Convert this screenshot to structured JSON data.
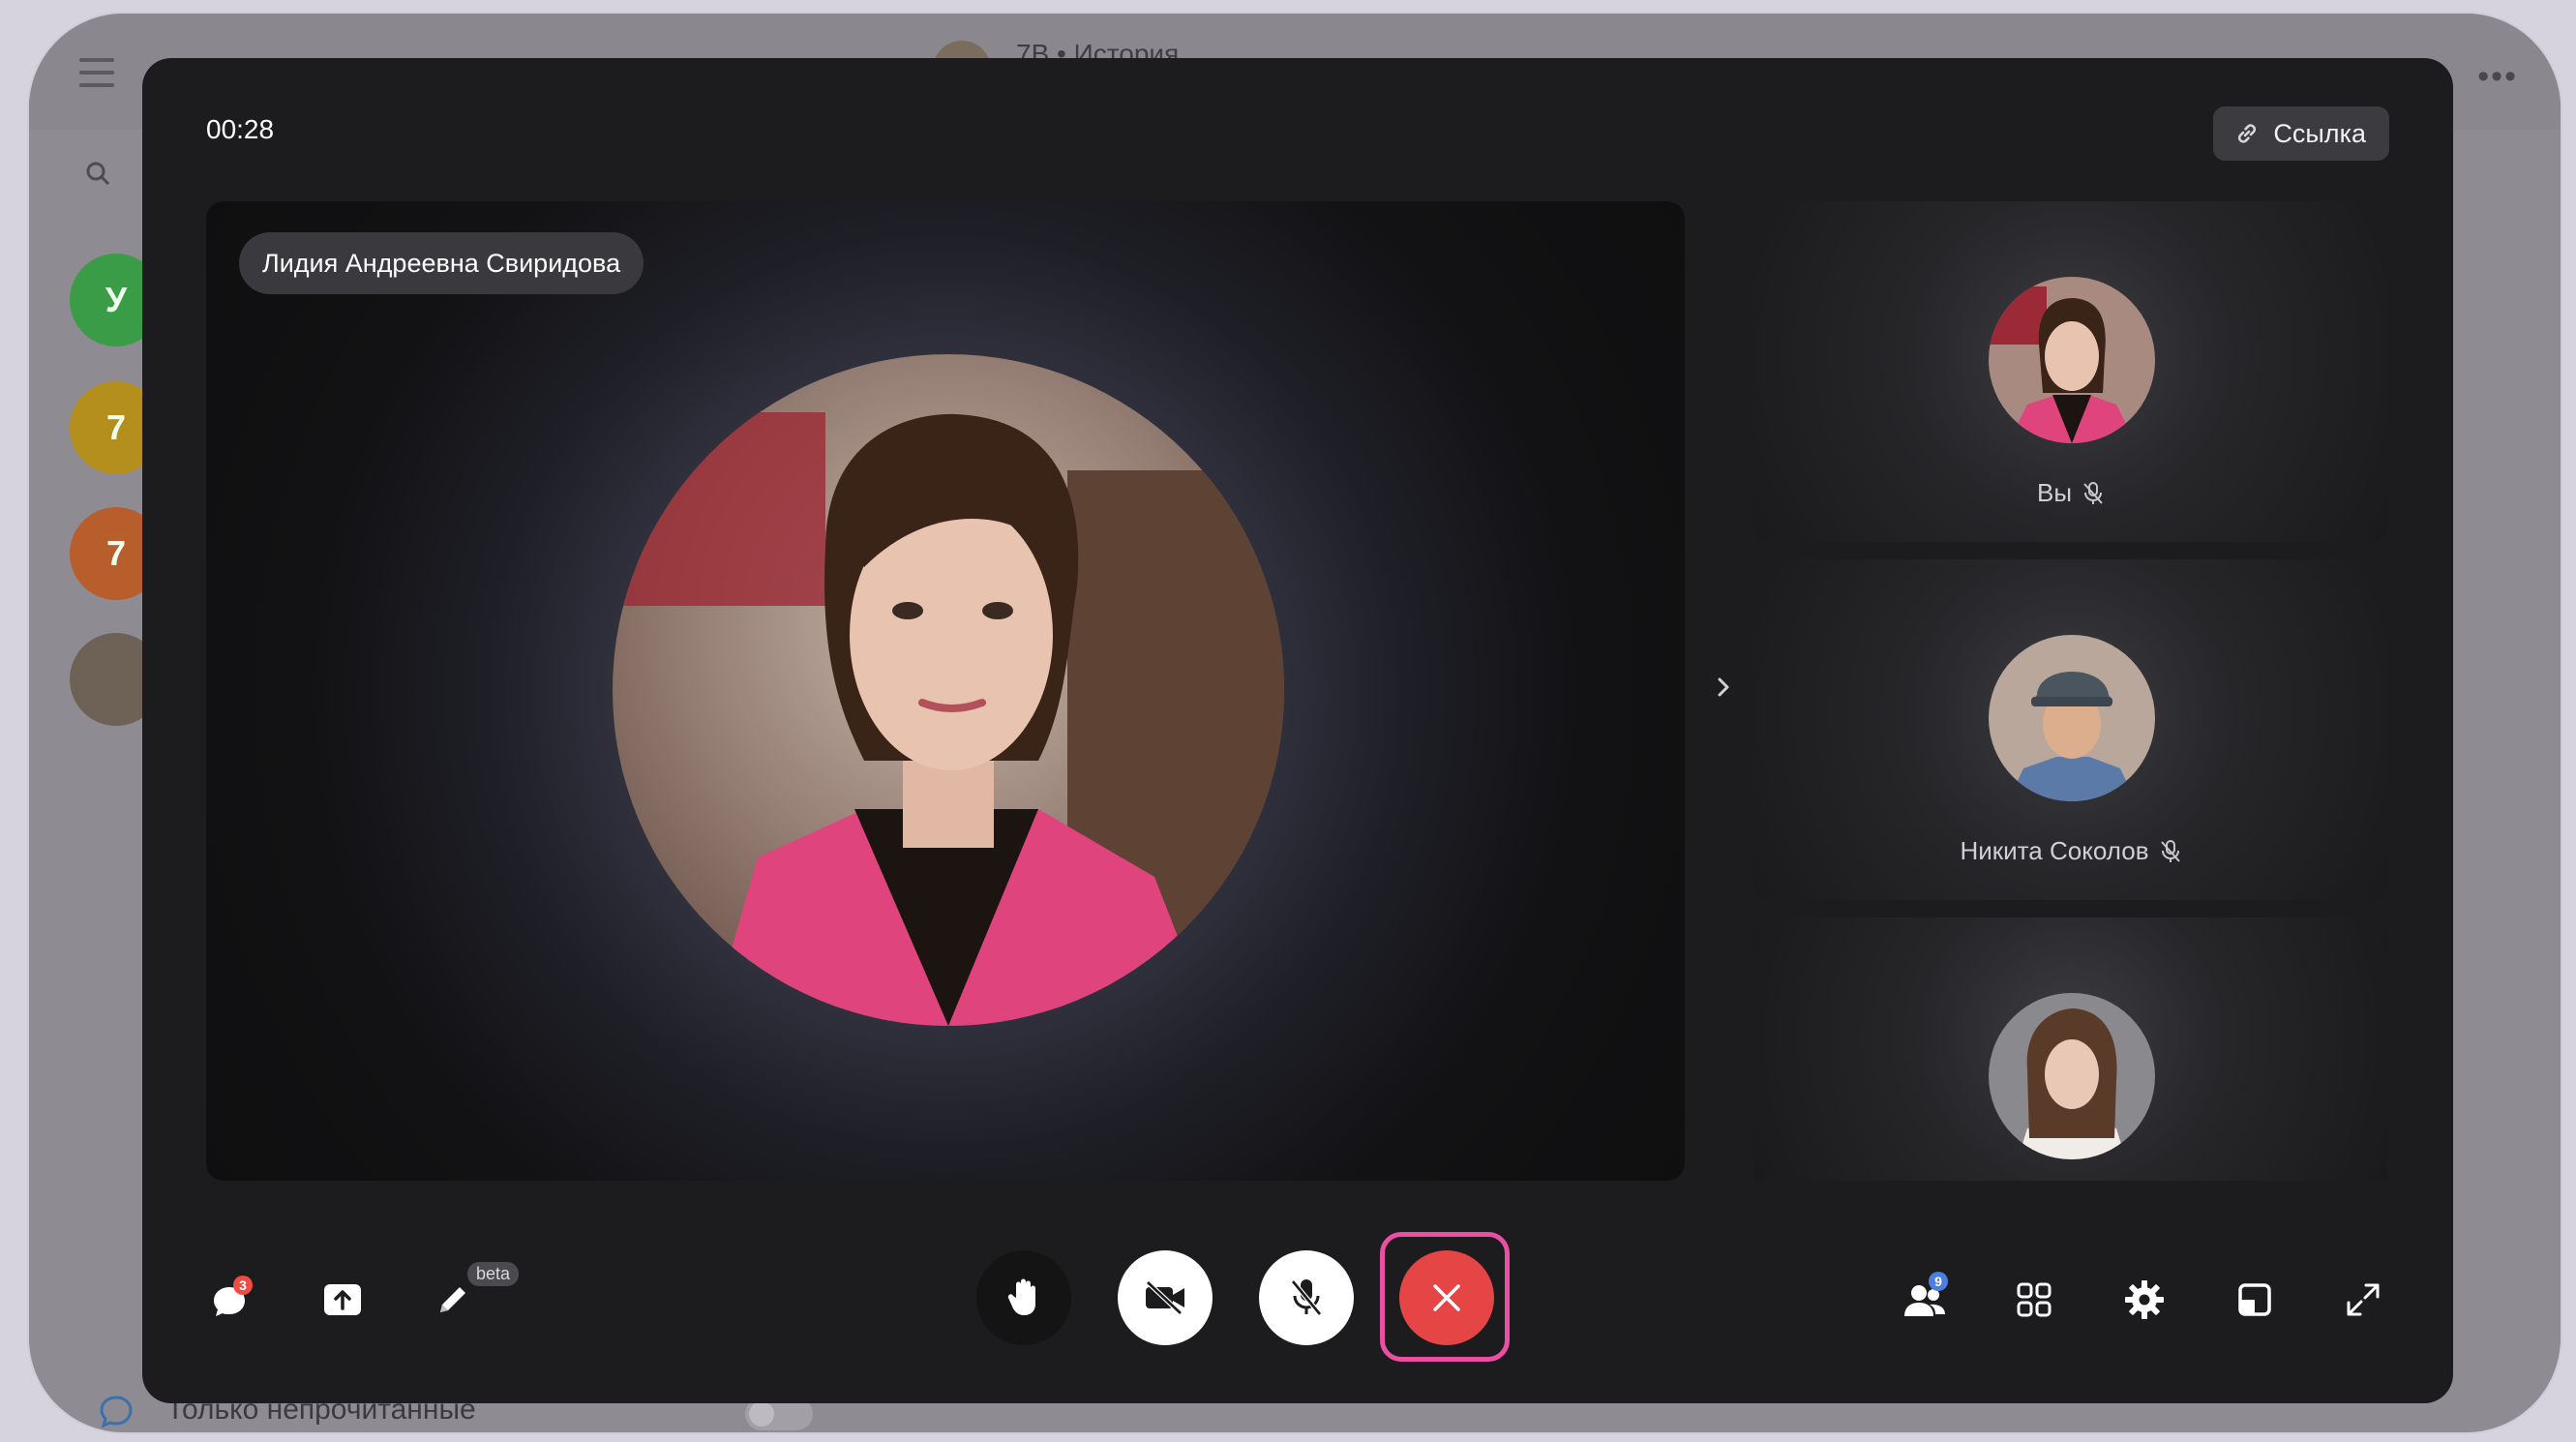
{
  "background_app": {
    "chat_title": "7В • История",
    "avatars": [
      {
        "letter": "У",
        "color": "#2f8a3a"
      },
      {
        "letter": "7",
        "color": "#b48e1c"
      },
      {
        "letter": "7",
        "color": "#b65d2c"
      }
    ],
    "footer_label": "Только непрочитанные"
  },
  "call": {
    "timer": "00:28",
    "link_button_label": "Ссылка",
    "main_speaker_name": "Лидия Андреевна Свиридова",
    "participants": [
      {
        "name": "Вы",
        "muted": true
      },
      {
        "name": "Никита Соколов",
        "muted": true
      },
      {
        "name": "",
        "muted": false
      }
    ]
  },
  "toolbar": {
    "chat_badge": "3",
    "draw_beta_label": "beta",
    "participants_badge": "9"
  },
  "colors": {
    "call_bg": "#1c1c1e",
    "end_call": "#e54545",
    "highlight": "#ea4fa3",
    "badge_red": "#ef4d43",
    "badge_blue": "#4a7fe0"
  },
  "icons": [
    "chat-icon",
    "share-screen-icon",
    "pen-icon",
    "raise-hand-icon",
    "camera-off-icon",
    "mic-off-icon",
    "end-call-icon",
    "participants-icon",
    "grid-icon",
    "settings-icon",
    "layout-icon",
    "fullscreen-icon",
    "link-icon",
    "chevron-right-icon"
  ]
}
